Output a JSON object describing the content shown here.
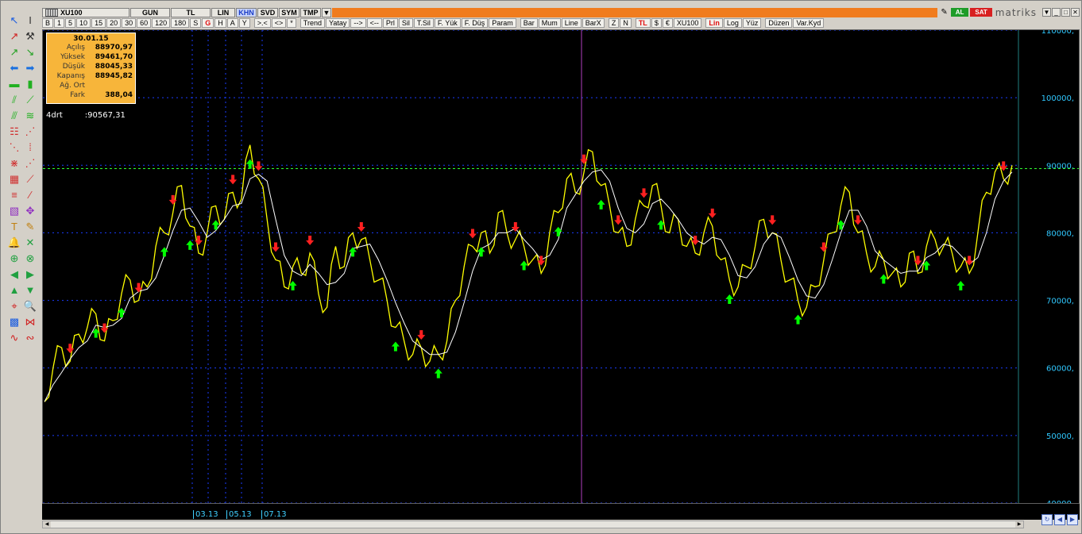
{
  "titlebar": {
    "symbol": "XU100",
    "tabs": [
      "GUN",
      "TL",
      "LIN",
      "KHN",
      "SVD",
      "SYM",
      "TMP"
    ],
    "active_tab": "KHN",
    "al_label": "AL",
    "sat_label": "SAT",
    "brand": "matriks"
  },
  "toolbar": {
    "periods": [
      "B",
      "1",
      "5",
      "10",
      "15",
      "20",
      "30",
      "60",
      "120",
      "180",
      "S",
      "G",
      "H",
      "A",
      "Y"
    ],
    "nav": [
      ">.<",
      "<>",
      "*"
    ],
    "tools": [
      "Trend",
      "Yatay",
      "-->",
      "<--",
      "Prl",
      "Sil",
      "T.Sil",
      "F. Yük",
      "F. Düş",
      "Param"
    ],
    "chart_types": [
      "Bar",
      "Mum",
      "Line",
      "BarX"
    ],
    "zoom": [
      "Z",
      "N"
    ],
    "currency": [
      "TL",
      "$",
      "€",
      "XU100"
    ],
    "scale": [
      "Lin",
      "Log",
      "Yüz"
    ],
    "edit": [
      "Düzen",
      "Var.Kyd"
    ]
  },
  "infobox": {
    "date": "30.01.15",
    "rows": [
      {
        "label": "Açılış",
        "value": "88970,97"
      },
      {
        "label": "Yüksek",
        "value": "89461,70"
      },
      {
        "label": "Düşük",
        "value": "88045,33"
      },
      {
        "label": "Kapanış",
        "value": "88945,82"
      },
      {
        "label": "Ağ. Ort",
        "value": ""
      },
      {
        "label": "Fark",
        "value": "388,04"
      }
    ]
  },
  "indicator": {
    "name": "4drt",
    "value": ":90567,31"
  },
  "colors": {
    "price": "#ffff00",
    "ma": "#ffffff",
    "up": "#00ff00",
    "down": "#ff2020",
    "axis": "#30c8ff",
    "grid": "#1a3cff",
    "hline": "#30ff30",
    "vline": "#b040c0"
  },
  "chart_data": {
    "type": "line",
    "y_ticks": [
      "110000,",
      "100000,",
      "90000,",
      "80000,",
      "70000,",
      "60000,",
      "50000,",
      "40000,"
    ],
    "x_ticks": [
      "03.13",
      "05.13",
      "07.13"
    ],
    "ylim": [
      40000,
      110000
    ],
    "series": [
      {
        "name": "XU100",
        "values": [
          55000,
          60000,
          63000,
          61000,
          65000,
          66000,
          68000,
          64000,
          67000,
          71000,
          73000,
          70000,
          72000,
          78000,
          80000,
          83000,
          87000,
          81000,
          77000,
          80000,
          84000,
          82000,
          86000,
          85000,
          93000,
          88000,
          82000,
          76000,
          72000,
          75000,
          74000,
          77000,
          71000,
          69000,
          78000,
          75000,
          80000,
          79000,
          76000,
          73000,
          70000,
          66000,
          64000,
          62000,
          63000,
          61000,
          62000,
          64000,
          70000,
          75000,
          78000,
          80000,
          77000,
          83000,
          80000,
          79000,
          78000,
          76000,
          74000,
          80000,
          83000,
          88000,
          86000,
          89000,
          92000,
          87000,
          84000,
          80000,
          78000,
          82000,
          84000,
          87000,
          84000,
          80000,
          82000,
          78000,
          77000,
          80000,
          81000,
          76000,
          73000,
          72000,
          75000,
          78000,
          82000,
          80000,
          76000,
          73000,
          70000,
          69000,
          72000,
          76000,
          80000,
          84000,
          86000,
          80000,
          77000,
          75000,
          76000,
          74000,
          72000,
          77000,
          74000,
          78000,
          79000,
          78000,
          77000,
          75000,
          74000,
          80000,
          86000,
          89000,
          88000,
          90000
        ]
      }
    ],
    "up_signals": [
      6,
      9,
      14,
      17,
      20,
      24,
      29,
      36,
      41,
      46,
      51,
      56,
      60,
      65,
      72,
      80,
      88,
      93,
      98,
      103,
      107
    ],
    "down_signals": [
      3,
      7,
      11,
      15,
      18,
      22,
      25,
      27,
      31,
      37,
      44,
      50,
      55,
      58,
      63,
      67,
      70,
      76,
      78,
      85,
      91,
      95,
      102,
      108,
      112
    ]
  }
}
